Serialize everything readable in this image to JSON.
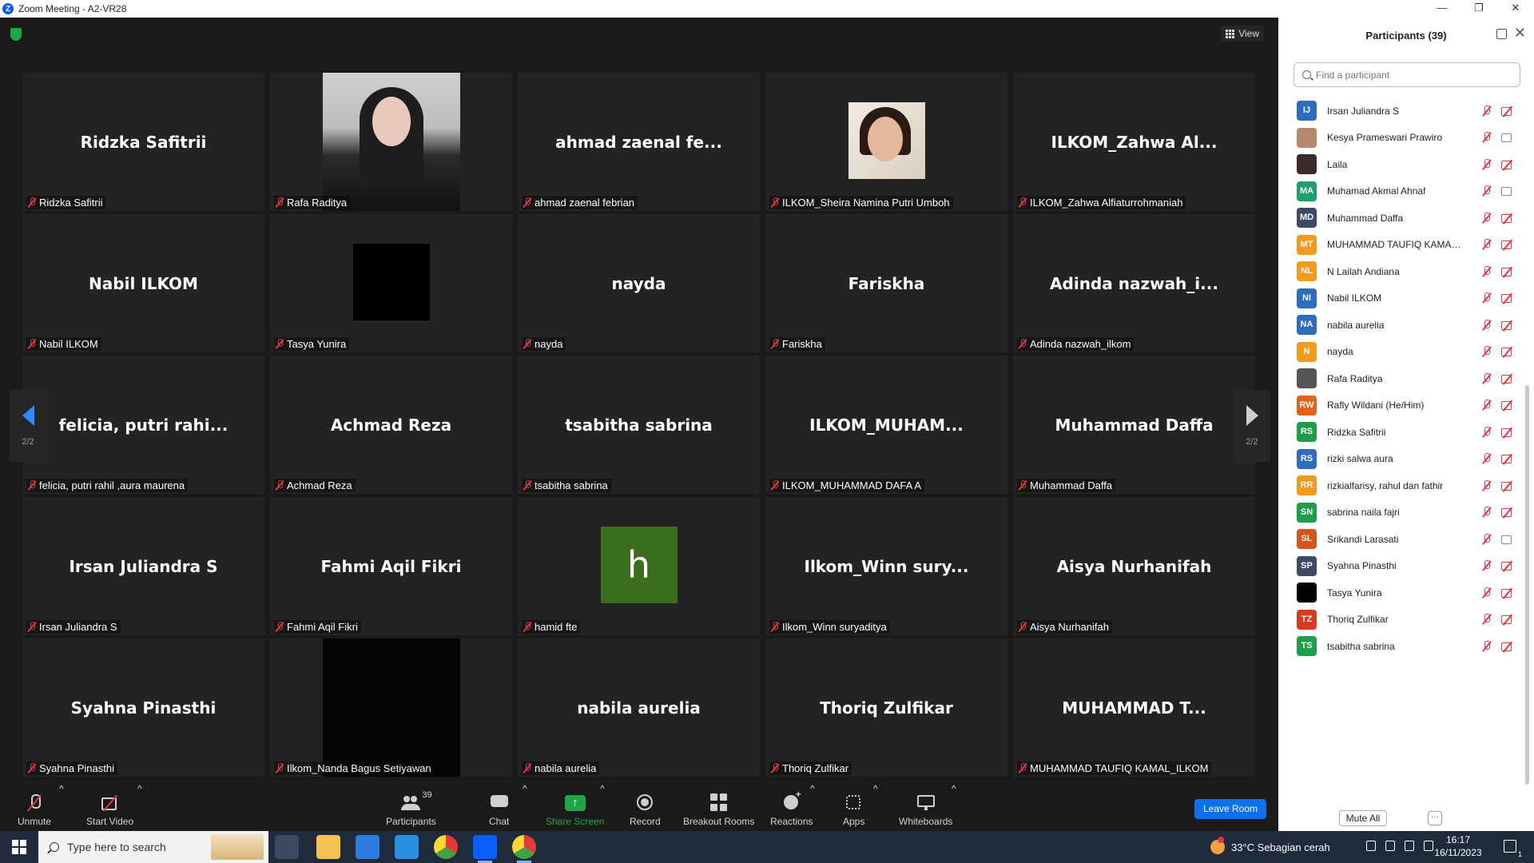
{
  "window": {
    "title": "Zoom Meeting - A2-VR28",
    "minimize": "—",
    "maximize": "❐",
    "close": "✕"
  },
  "meeting": {
    "view_label": "View",
    "page_indicator": "2/2",
    "tiles": [
      {
        "big": "Ridzka Safitrii",
        "label": "Ridzka Safitrii",
        "media": "name"
      },
      {
        "big": "",
        "label": "Rafa Raditya",
        "media": "photo1"
      },
      {
        "big": "ahmad zaenal fe...",
        "label": "ahmad zaenal febrian",
        "media": "name"
      },
      {
        "big": "",
        "label": "ILKOM_Sheira Namina Putri Umboh",
        "media": "photo2"
      },
      {
        "big": "ILKOM_Zahwa  Al...",
        "label": "ILKOM_Zahwa Alfiaturrohmaniah",
        "media": "name"
      },
      {
        "big": "Nabil ILKOM",
        "label": "Nabil ILKOM",
        "media": "name"
      },
      {
        "big": "",
        "label": "Tasya Yunira",
        "media": "black"
      },
      {
        "big": "nayda",
        "label": "nayda",
        "media": "name"
      },
      {
        "big": "Fariskha",
        "label": "Fariskha",
        "media": "name"
      },
      {
        "big": "Adinda  nazwah_i...",
        "label": "Adinda nazwah_ilkom",
        "media": "name"
      },
      {
        "big": "felicia,  putri rahi...",
        "label": "felicia, putri rahil ,aura maurena",
        "media": "name"
      },
      {
        "big": "Achmad Reza",
        "label": "Achmad Reza",
        "media": "name"
      },
      {
        "big": "tsabitha sabrina",
        "label": "tsabitha sabrina",
        "media": "name"
      },
      {
        "big": "ILKOM_MUHAM...",
        "label": "ILKOM_MUHAMMAD DAFA A",
        "media": "name"
      },
      {
        "big": "Muhammad Daffa",
        "label": "Muhammad Daffa",
        "media": "name"
      },
      {
        "big": "Irsan Juliandra S",
        "label": "Irsan Juliandra S",
        "media": "name"
      },
      {
        "big": "Fahmi Aqil Fikri",
        "label": "Fahmi Aqil Fikri",
        "media": "name"
      },
      {
        "big": "h",
        "label": "hamid fte",
        "media": "letter"
      },
      {
        "big": "Ilkom_Winn  sury...",
        "label": "Ilkom_Winn suryaditya",
        "media": "name"
      },
      {
        "big": "Aisya Nurhanifah",
        "label": "Aisya Nurhanifah",
        "media": "name"
      },
      {
        "big": "Syahna Pinasthi",
        "label": "Syahna Pinasthi",
        "media": "name"
      },
      {
        "big": "",
        "label": "Ilkom_Nanda Bagus Setiyawan",
        "media": "blacktall"
      },
      {
        "big": "nabila aurelia",
        "label": "nabila aurelia",
        "media": "name"
      },
      {
        "big": "Thoriq Zulfikar",
        "label": "Thoriq Zulfikar",
        "media": "name"
      },
      {
        "big": "MUHAMMAD  T...",
        "label": "MUHAMMAD TAUFIQ KAMAL_ILKOM",
        "media": "name"
      }
    ]
  },
  "toolbar": {
    "unmute": "Unmute",
    "start_video": "Start Video",
    "participants": "Participants",
    "participants_count": "39",
    "chat": "Chat",
    "share_screen": "Share Screen",
    "record": "Record",
    "breakout_rooms": "Breakout Rooms",
    "reactions": "Reactions",
    "apps": "Apps",
    "whiteboards": "Whiteboards",
    "leave_room": "Leave Room",
    "caret": "^"
  },
  "panel": {
    "title": "Participants (39)",
    "search_placeholder": "Find a participant",
    "mute_all": "Mute All",
    "more": "···",
    "participants": [
      {
        "initials": "IJ",
        "name": "Irsan Juliandra S",
        "color": "#2d6cc0",
        "video": "off"
      },
      {
        "initials": "",
        "name": "Kesya Prameswari Prawiro",
        "color": "#b48a6e",
        "video": "on"
      },
      {
        "initials": "",
        "name": "Laila",
        "color": "#3b2a2a",
        "video": "off"
      },
      {
        "initials": "MA",
        "name": "Muhamad Akmal Ahnaf",
        "color": "#1e9e6a",
        "video": "on"
      },
      {
        "initials": "MD",
        "name": "Muhammad Daffa",
        "color": "#3c4a66",
        "video": "off"
      },
      {
        "initials": "MT",
        "name": "MUHAMMAD TAUFIQ KAMAL_I...",
        "color": "#f39b1d",
        "video": "off"
      },
      {
        "initials": "NL",
        "name": "N Lailah Andiana",
        "color": "#f39b1d",
        "video": "off"
      },
      {
        "initials": "NI",
        "name": "Nabil ILKOM",
        "color": "#2d6cc0",
        "video": "off"
      },
      {
        "initials": "NA",
        "name": "nabila aurelia",
        "color": "#2d6cc0",
        "video": "off"
      },
      {
        "initials": "N",
        "name": "nayda",
        "color": "#f39b1d",
        "video": "off"
      },
      {
        "initials": "",
        "name": "Rafa Raditya",
        "color": "#555555",
        "video": "off"
      },
      {
        "initials": "RW",
        "name": "Rafly Wildani (He/Him)",
        "color": "#e0621b",
        "video": "off"
      },
      {
        "initials": "RS",
        "name": "Ridzka Safitrii",
        "color": "#1e9e4a",
        "video": "off"
      },
      {
        "initials": "RS",
        "name": "rizki salwa aura",
        "color": "#2d6cc0",
        "video": "off"
      },
      {
        "initials": "RR",
        "name": "rizkialfarisy, rahul dan fathir",
        "color": "#f39b1d",
        "video": "off"
      },
      {
        "initials": "SN",
        "name": "sabrina naila fajri",
        "color": "#1e9e4a",
        "video": "off"
      },
      {
        "initials": "SL",
        "name": "Srikandi Larasati",
        "color": "#d9531e",
        "video": "on"
      },
      {
        "initials": "SP",
        "name": "Syahna Pinasthi",
        "color": "#3c4a66",
        "video": "off"
      },
      {
        "initials": "",
        "name": "Tasya Yunira",
        "color": "#000000",
        "video": "off"
      },
      {
        "initials": "TZ",
        "name": "Thoriq Zulfikar",
        "color": "#d9391e",
        "video": "off"
      },
      {
        "initials": "TS",
        "name": "tsabitha sabrina",
        "color": "#1e9e4a",
        "video": "off"
      }
    ]
  },
  "taskbar": {
    "search_placeholder": "Type here to search",
    "weather": "33°C  Sebagian cerah",
    "time": "16:17",
    "date": "16/11/2023",
    "notification_count": "1"
  }
}
